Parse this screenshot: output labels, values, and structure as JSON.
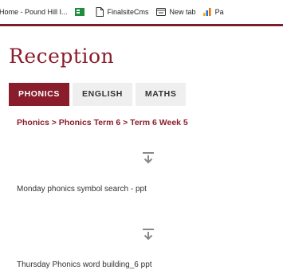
{
  "bookmarks_bar": {
    "items": [
      {
        "label": "Home - Pound Hill I...",
        "icon": "globe-icon"
      },
      {
        "label": "",
        "icon": "green-table-icon"
      },
      {
        "label": "FinalsiteCms",
        "icon": "page-icon"
      },
      {
        "label": "New tab",
        "icon": "new-tab-icon"
      },
      {
        "label": "Pa",
        "icon": "bar-chart-icon"
      }
    ]
  },
  "header": {
    "title": "Reception",
    "accent_color": "#8a1d2c"
  },
  "tabs": [
    {
      "label": "PHONICS",
      "active": true
    },
    {
      "label": "ENGLISH",
      "active": false
    },
    {
      "label": "MATHS",
      "active": false
    }
  ],
  "breadcrumb": "Phonics > Phonics Term 6 > Term 6 Week 5",
  "files": [
    {
      "icon": "download-icon",
      "label": "Monday phonics symbol search - ppt"
    },
    {
      "icon": "download-icon",
      "label": "Thursday Phonics word building_6 ppt"
    }
  ]
}
